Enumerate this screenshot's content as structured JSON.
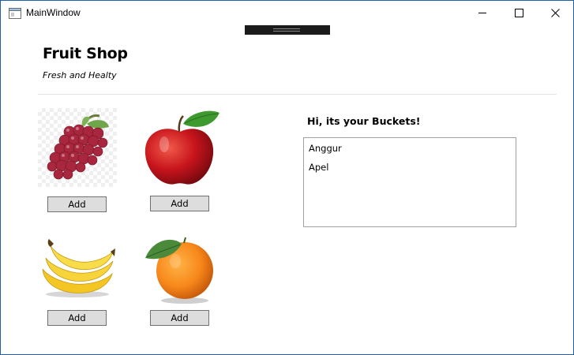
{
  "window": {
    "title": "MainWindow",
    "controls": {
      "minimize": "minimize-icon",
      "maximize": "maximize-icon",
      "close": "close-icon"
    }
  },
  "header": {
    "title": "Fruit Shop",
    "subtitle": "Fresh and Healty"
  },
  "products": [
    {
      "name": "grapes",
      "icon": "grapes-image",
      "button_label": "Add"
    },
    {
      "name": "apple",
      "icon": "apple-image",
      "button_label": "Add"
    },
    {
      "name": "banana",
      "icon": "banana-image",
      "button_label": "Add"
    },
    {
      "name": "orange",
      "icon": "orange-image",
      "button_label": "Add"
    }
  ],
  "bucket": {
    "heading": "Hi, its your Buckets!",
    "items": [
      "Anggur",
      "Apel"
    ]
  },
  "colors": {
    "window_border": "#1e5fa8",
    "button_bg": "#dddddd",
    "button_border": "#707070",
    "list_border": "#a0a0a0"
  }
}
